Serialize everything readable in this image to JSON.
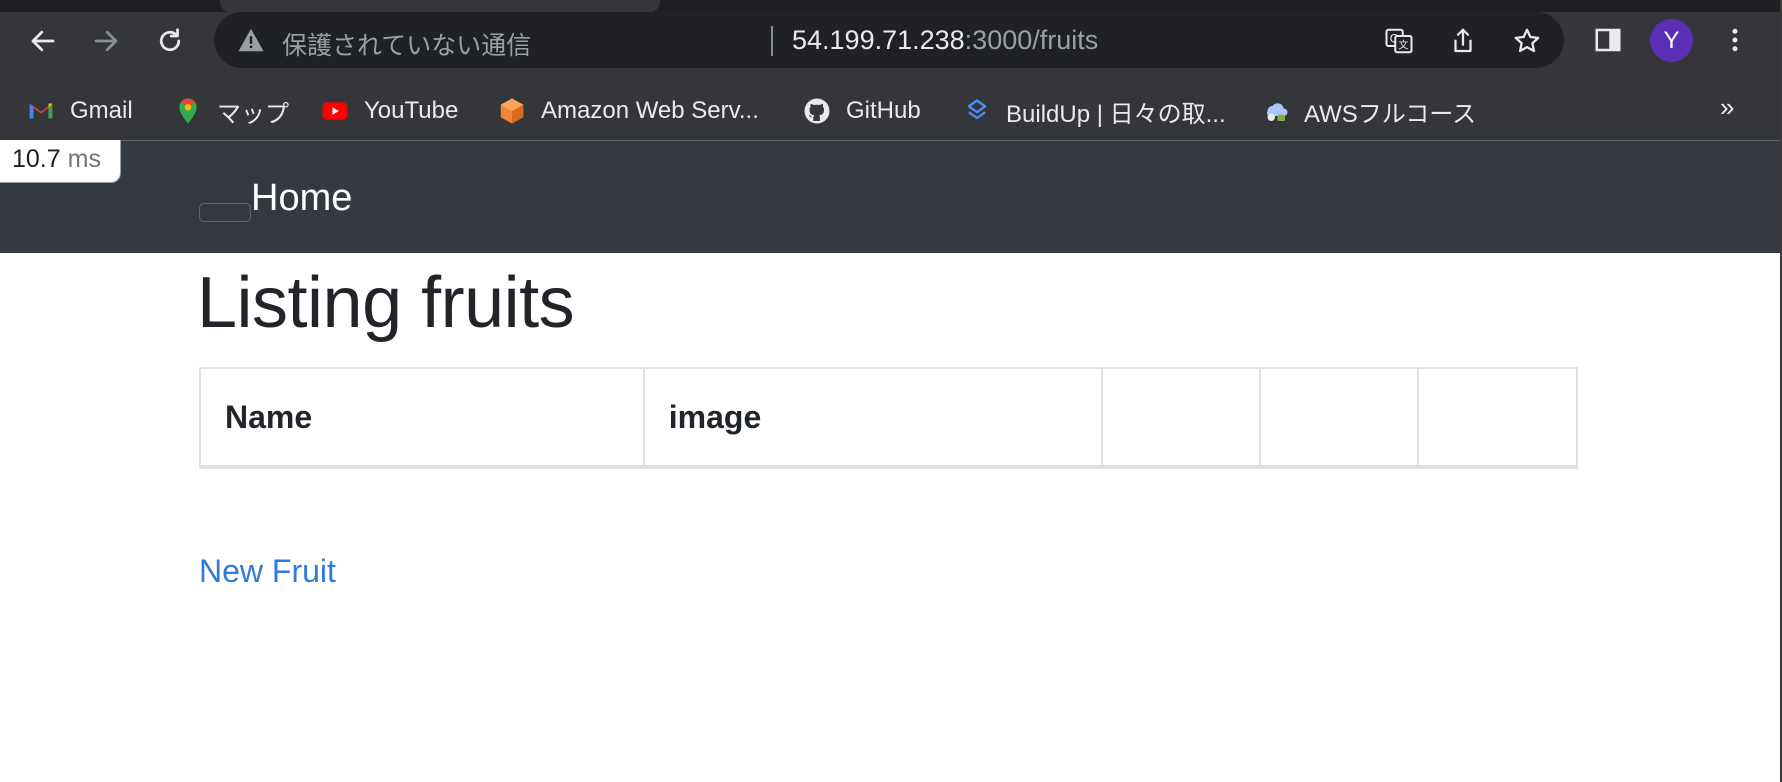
{
  "browser": {
    "security_warning": "保護されていない通信",
    "url_host": "54.199.71.238",
    "url_path": ":3000/fruits",
    "profile_initial": "Y",
    "bookmarks": [
      {
        "label": "Gmail",
        "icon": "gmail-icon"
      },
      {
        "label": "マップ",
        "icon": "maps-icon"
      },
      {
        "label": "YouTube",
        "icon": "youtube-icon"
      },
      {
        "label": "Amazon Web Serv...",
        "icon": "aws-icon"
      },
      {
        "label": "GitHub",
        "icon": "github-icon"
      },
      {
        "label": "BuildUp | 日々の取...",
        "icon": "buildup-icon"
      },
      {
        "label": "AWSフルコース",
        "icon": "aws-course-icon"
      }
    ],
    "bookmarks_overflow": "»"
  },
  "profiler": {
    "value": "10.7",
    "unit": "ms"
  },
  "navbar": {
    "brand": "Home"
  },
  "page": {
    "title": "Listing fruits",
    "table_headers": [
      "Name",
      "image",
      "",
      "",
      ""
    ],
    "new_link": "New Fruit"
  },
  "colors": {
    "chrome_bg": "#35363a",
    "omnibox_bg": "#202124",
    "navbar_bg": "#343a40",
    "link": "#2f7bd9",
    "avatar": "#5b2fb5"
  }
}
